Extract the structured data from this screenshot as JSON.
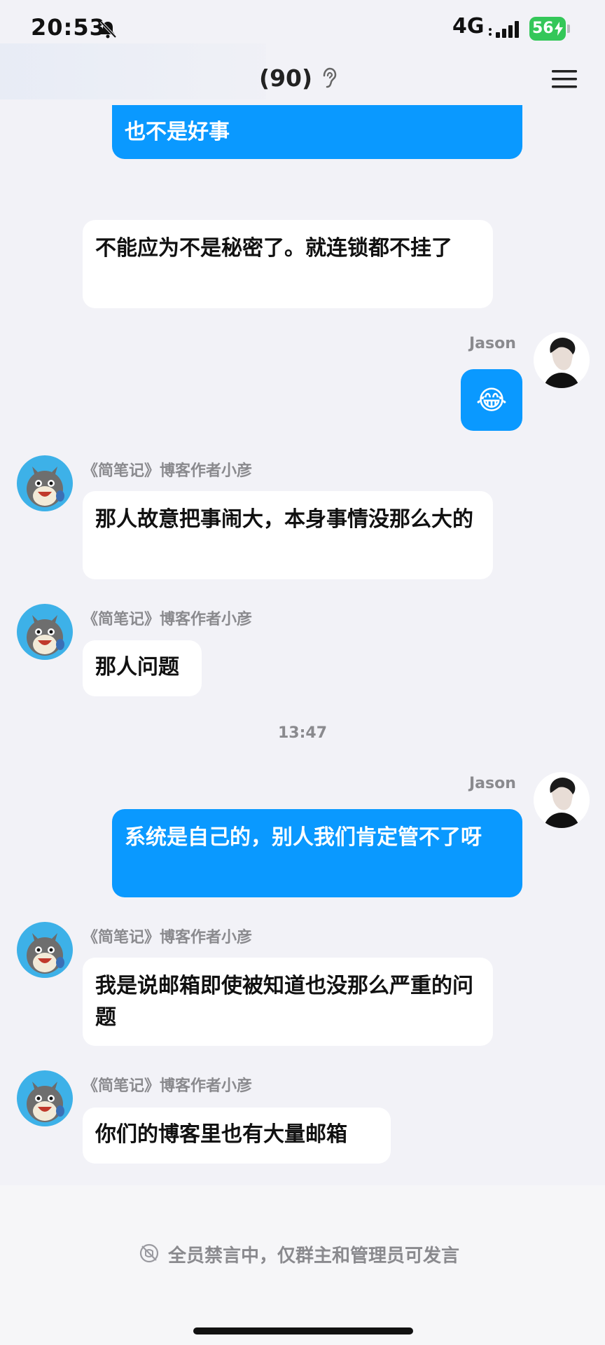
{
  "status_bar": {
    "time": "20:53",
    "network": "4G",
    "battery": "56"
  },
  "header": {
    "title": "(90)"
  },
  "messages": [
    {
      "side": "out",
      "text": "也不是好事"
    },
    {
      "side": "in",
      "text": "不能应为不是秘密了。就连锁都不挂了"
    },
    {
      "side": "out",
      "sender": "Jason",
      "text": "😂"
    },
    {
      "side": "in",
      "sender": "《简笔记》博客作者小彦",
      "text": "那人故意把事闹大，本身事情没那么大的"
    },
    {
      "side": "in",
      "sender": "《简笔记》博客作者小彦",
      "text": "那人问题"
    },
    {
      "side": "out",
      "sender": "Jason",
      "text": "系统是自己的，别人我们肯定管不了呀"
    },
    {
      "side": "in",
      "sender": "《简笔记》博客作者小彦",
      "text": "我是说邮箱即使被知道也没那么严重的问题"
    },
    {
      "side": "in",
      "sender": "《简笔记》博客作者小彦",
      "text": "你们的博客里也有大量邮箱"
    }
  ],
  "timestamp": "13:47",
  "footer": {
    "mute_notice": "全员禁言中，仅群主和管理员可发言"
  },
  "colors": {
    "out_bubble": "#0a99ff",
    "in_bubble": "#ffffff",
    "background": "#f2f2f7"
  }
}
